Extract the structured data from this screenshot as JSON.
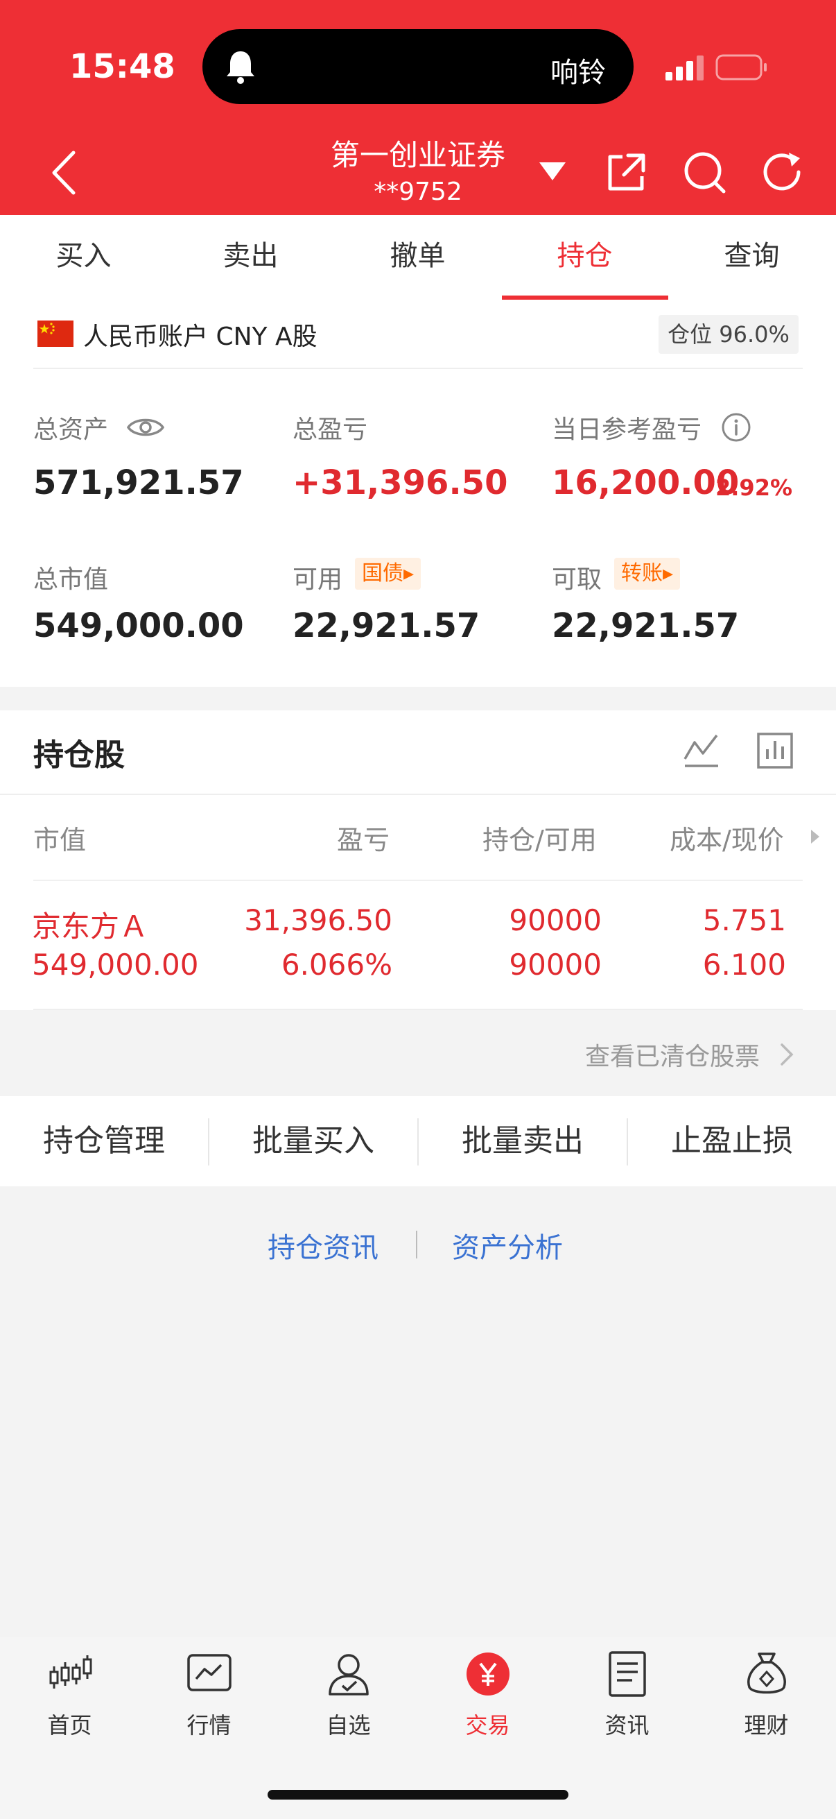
{
  "status_bar": {
    "time": "15:48",
    "island_text": "响铃"
  },
  "header": {
    "title": "第一创业证券",
    "account": "**9752"
  },
  "tabs": [
    {
      "label": "买入"
    },
    {
      "label": "卖出"
    },
    {
      "label": "撤单"
    },
    {
      "label": "持仓",
      "active": true
    },
    {
      "label": "查询"
    }
  ],
  "account": {
    "label": "人民币账户 CNY A股",
    "position_ratio": "仓位 96.0%"
  },
  "stats": {
    "total_assets_label": "总资产",
    "total_assets": "571,921.57",
    "total_pnl_label": "总盈亏",
    "total_pnl": "+31,396.50",
    "daily_pnl_label": "当日参考盈亏",
    "daily_pnl": "16,200.00",
    "daily_pnl_pct": "2.92%",
    "market_value_label": "总市值",
    "market_value": "549,000.00",
    "available_label": "可用",
    "available_tag": "国债",
    "available": "22,921.57",
    "withdrawable_label": "可取",
    "withdrawable_tag": "转账",
    "withdrawable": "22,921.57"
  },
  "holdings": {
    "title": "持仓股",
    "columns": [
      "市值",
      "盈亏",
      "持仓/可用",
      "成本/现价"
    ],
    "rows": [
      {
        "name": "京东方Ａ",
        "market_value": "549,000.00",
        "pnl": "31,396.50",
        "pnl_pct": "6.066%",
        "position": "90000",
        "available": "90000",
        "cost": "5.751",
        "price": "6.100"
      }
    ],
    "cleared_link": "查看已清仓股票"
  },
  "actions": [
    "持仓管理",
    "批量买入",
    "批量卖出",
    "止盈止损"
  ],
  "links": [
    "持仓资讯",
    "资产分析"
  ],
  "bottom_nav": [
    {
      "label": "首页",
      "icon": "candlestick-icon"
    },
    {
      "label": "行情",
      "icon": "market-chart-icon"
    },
    {
      "label": "自选",
      "icon": "user-check-icon"
    },
    {
      "label": "交易",
      "icon": "yuan-icon",
      "active": true
    },
    {
      "label": "资讯",
      "icon": "document-icon"
    },
    {
      "label": "理财",
      "icon": "money-bag-icon"
    }
  ],
  "colors": {
    "brand_red": "#ee2f35",
    "profit_red": "#e02a2f",
    "link_blue": "#3a72d2",
    "tag_orange": "#ff6a00"
  }
}
